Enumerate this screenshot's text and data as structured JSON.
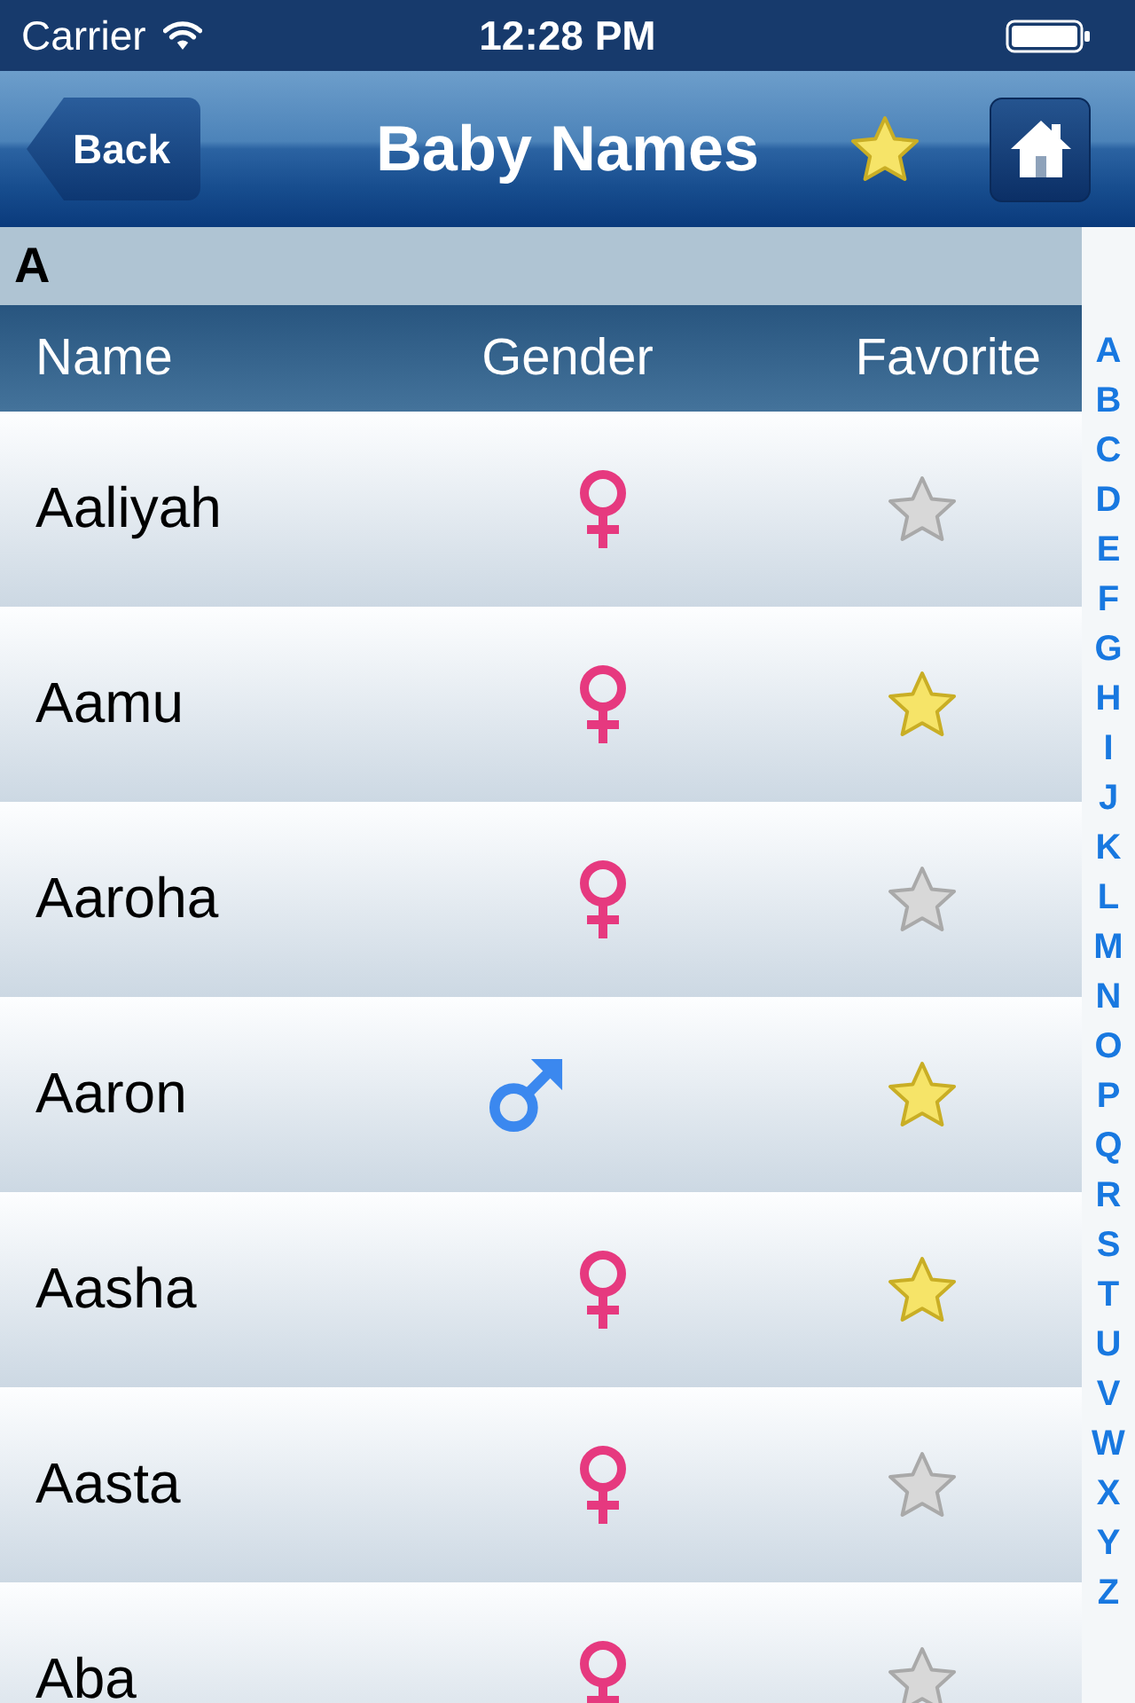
{
  "status_bar": {
    "carrier": "Carrier",
    "time": "12:28 PM"
  },
  "nav_bar": {
    "back": "Back",
    "title": "Baby Names"
  },
  "section": {
    "title": "A"
  },
  "table": {
    "columns": [
      "Name",
      "Gender",
      "Favorite"
    ],
    "rows": [
      {
        "name": "Aaliyah",
        "kind": "female",
        "favorite": false
      },
      {
        "name": "Aamu",
        "kind": "female",
        "favorite": true
      },
      {
        "name": "Aaroha",
        "kind": "female",
        "favorite": false
      },
      {
        "name": "Aaron",
        "kind": "male",
        "favorite": true
      },
      {
        "name": "Aasha",
        "kind": "female",
        "favorite": true
      },
      {
        "name": "Aasta",
        "kind": "female",
        "favorite": false
      },
      {
        "name": "Aba",
        "kind": "female",
        "favorite": false
      }
    ]
  },
  "index": [
    "A",
    "B",
    "C",
    "D",
    "E",
    "F",
    "G",
    "H",
    "I",
    "J",
    "K",
    "L",
    "M",
    "N",
    "O",
    "P",
    "Q",
    "R",
    "S",
    "T",
    "U",
    "V",
    "W",
    "X",
    "Y",
    "Z"
  ]
}
